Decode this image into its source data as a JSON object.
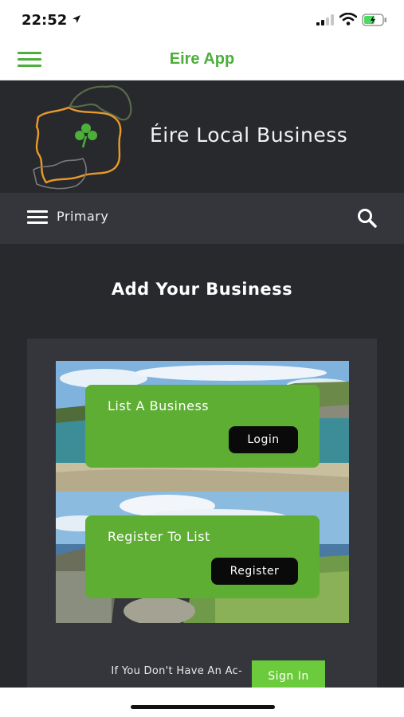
{
  "status_bar": {
    "time": "22:52"
  },
  "app_bar": {
    "title": "Eire App"
  },
  "site_header": {
    "title": "Éire Local Business"
  },
  "primary_nav": {
    "label": "Primary"
  },
  "main": {
    "page_title": "Add Your Business",
    "cards": [
      {
        "label": "List A Business",
        "button": "Login"
      },
      {
        "label": "Register To List",
        "button": "Register"
      }
    ],
    "signin_text": "If You Don't Have An Ac-",
    "signin_button": "Sign In"
  },
  "colors": {
    "accent_green": "#5eae33",
    "header_bg": "#28292d",
    "nav_bg": "#35363b",
    "app_title": "#4caf3a"
  },
  "icons": [
    "menu-icon",
    "location-arrow-icon",
    "signal-icon",
    "wifi-icon",
    "battery-icon",
    "search-icon",
    "ireland-map-logo"
  ]
}
